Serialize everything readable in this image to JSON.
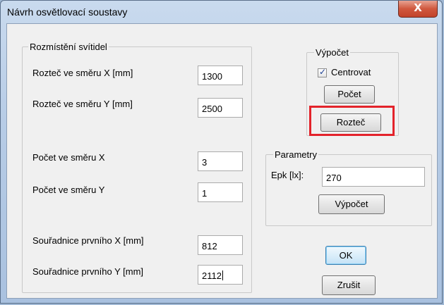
{
  "window": {
    "title": "Návrh osvětlovací soustavy"
  },
  "close_button": {
    "label": "X"
  },
  "placement_group": {
    "label": "Rozmístění svítidel",
    "spacing_x": {
      "label": "Rozteč ve směru X [mm]",
      "value": "1300"
    },
    "spacing_y": {
      "label": "Rozteč ve směru Y [mm]",
      "value": "2500"
    },
    "count_x": {
      "label": "Počet ve směru X",
      "value": "3"
    },
    "count_y": {
      "label": "Počet ve směru Y",
      "value": "1"
    },
    "first_x": {
      "label": "Souřadnice prvního X [mm]",
      "value": "812"
    },
    "first_y": {
      "label": "Souřadnice prvního Y [mm]",
      "value": "2112"
    }
  },
  "calc_group": {
    "label": "Výpočet",
    "center_checkbox": {
      "label": "Centrovat",
      "checked": true
    },
    "count_button": "Počet",
    "spacing_button": "Rozteč"
  },
  "params_group": {
    "label": "Parametry",
    "epk": {
      "label": "Epk [lx]:",
      "value": "270"
    },
    "calc_button": "Výpočet"
  },
  "ok_button": "OK",
  "cancel_button": "Zrušit",
  "colors": {
    "highlight": "#e3232b",
    "close_button": "#c9482f"
  }
}
